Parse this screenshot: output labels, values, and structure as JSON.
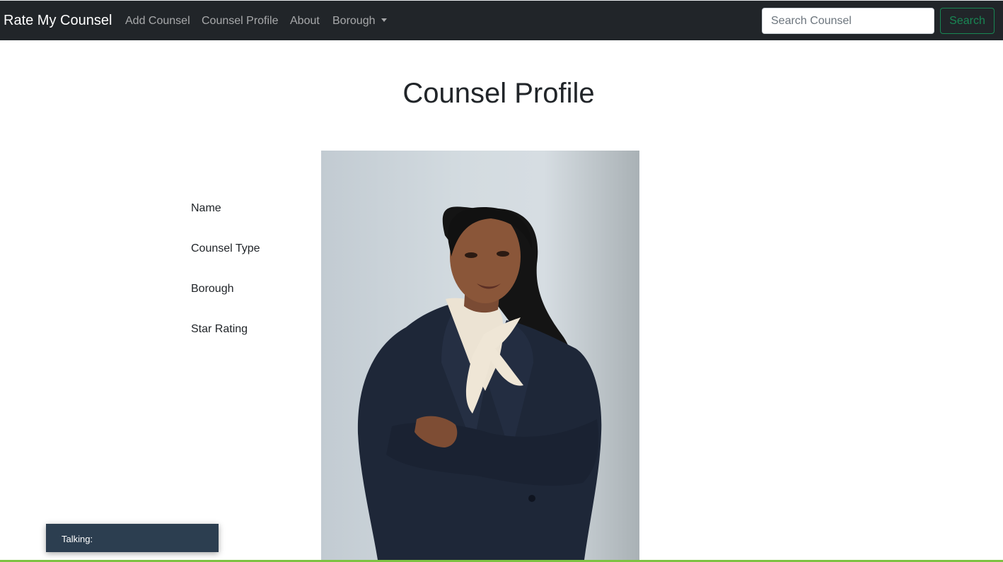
{
  "navbar": {
    "brand": "Rate My Counsel",
    "links": [
      {
        "label": "Add Counsel"
      },
      {
        "label": "Counsel Profile"
      },
      {
        "label": "About"
      }
    ],
    "dropdown": {
      "label": "Borough",
      "icon": "caret-down-icon"
    },
    "search": {
      "placeholder": "Search Counsel",
      "value": "",
      "button_label": "Search"
    },
    "colors": {
      "background": "#212529",
      "search_button": "#198754"
    }
  },
  "main": {
    "title": "Counsel Profile",
    "fields": [
      {
        "label": "Name"
      },
      {
        "label": "Counsel Type"
      },
      {
        "label": "Borough"
      },
      {
        "label": "Star Rating"
      }
    ],
    "photo": {
      "icon": "counsel-portrait-photo"
    }
  },
  "voice_widget": {
    "label": "Talking:",
    "color": "#2c3e50"
  },
  "accent_bar_color": "#7dc242"
}
